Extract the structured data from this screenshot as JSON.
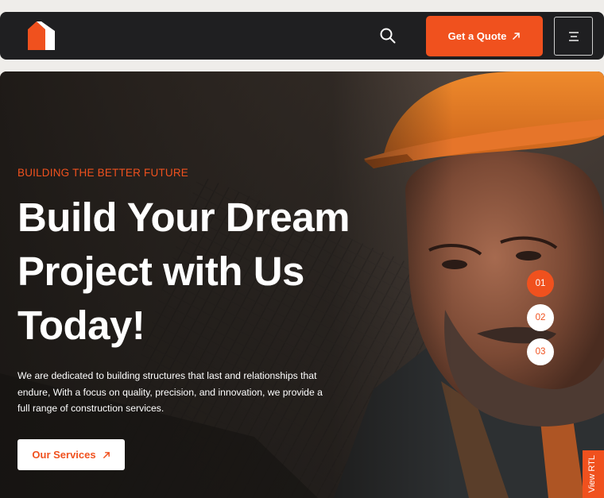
{
  "header": {
    "logo_icon": "house-logo-icon",
    "search_icon": "search-icon",
    "quote_label": "Get a Quote",
    "quote_icon": "arrow-up-right-icon",
    "menu_icon": "hamburger-menu-icon"
  },
  "hero": {
    "eyebrow": "BUILDING THE BETTER FUTURE",
    "headline": "Build Your Dream Project with Us Today!",
    "description": "We are dedicated to building structures that last and relationships that endure, With a focus on quality, precision, and innovation, we provide a full range of construction services.",
    "services_label": "Our Services",
    "services_icon": "arrow-up-right-icon"
  },
  "slider": {
    "dots": [
      "01",
      "02",
      "03"
    ],
    "active_index": 0
  },
  "rtl_tab": {
    "label": "View RTL"
  },
  "colors": {
    "accent": "#f0511e",
    "header_bg": "#1f1f21",
    "page_bg": "#efedea",
    "text_light": "#ffffff"
  }
}
